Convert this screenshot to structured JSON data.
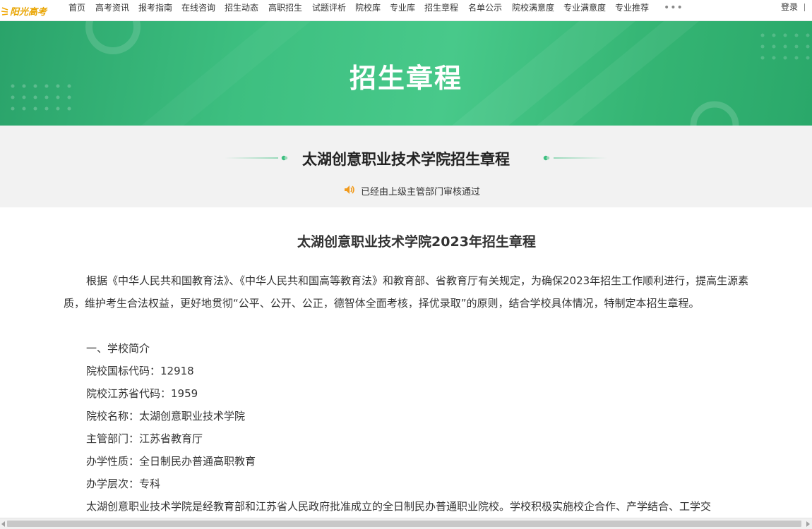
{
  "nav": {
    "logo_text": "阳光高考",
    "logo_icon": "sun-rays-icon",
    "items": [
      "首页",
      "高考资讯",
      "报考指南",
      "在线咨询",
      "招生动态",
      "高职招生",
      "试题评析",
      "院校库",
      "专业库",
      "招生章程",
      "名单公示",
      "院校满意度",
      "专业满意度",
      "专业推荐"
    ],
    "more_label": "•••",
    "login_label": "登录"
  },
  "banner": {
    "title": "招生章程",
    "accent_color": "#3dbf80"
  },
  "subheader": {
    "school_title": "太湖创意职业技术学院招生章程",
    "approval_icon": "speaker-icon",
    "approval_text": "已经由上级主管部门审核通过"
  },
  "document": {
    "title": "太湖创意职业技术学院2023年招生章程",
    "intro": "根据《中华人民共和国教育法》、《中华人民共和国高等教育法》和教育部、省教育厅有关规定，为确保2023年招生工作顺利进行，提高生源素质，维护考生合法权益，更好地贯彻“公平、公开、公正，德智体全面考核，择优录取”的原则，结合学校具体情况，特制定本招生章程。",
    "section1_heading": "一、学校简介",
    "national_code": "院校国标代码：12918",
    "province_code": "院校江苏省代码：1959",
    "school_name": "院校名称：太湖创意职业技术学院",
    "authority": "主管部门：江苏省教育厅",
    "nature": "办学性质：全日制民办普通高职教育",
    "level": "办学层次：专科",
    "description": "太湖创意职业技术学院是经教育部和江苏省人民政府批准成立的全日制民办普通职业院校。学校积极实施校企合作、产学结合、工学交"
  }
}
